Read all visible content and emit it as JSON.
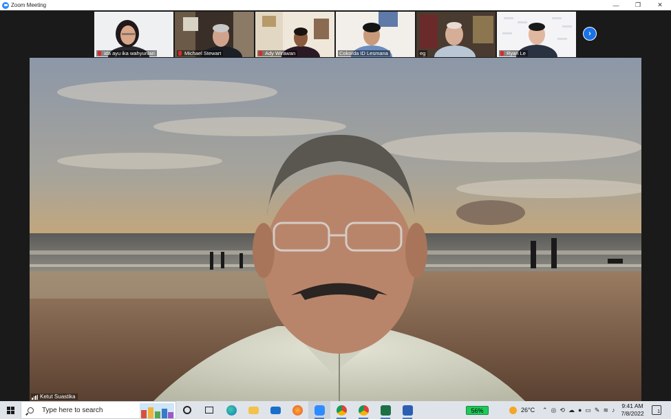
{
  "window": {
    "title": "Zoom Meeting",
    "controls": {
      "minimize": "—",
      "restore": "❐",
      "close": "✕"
    }
  },
  "gallery": {
    "participants": [
      {
        "name": "ida ayu ika wahyuniari",
        "muted": true
      },
      {
        "name": "Michael Stewart",
        "muted": true
      },
      {
        "name": "Ady Wirawan",
        "muted": true
      },
      {
        "name": "Cokorda ID Lesmana",
        "muted": false
      },
      {
        "name": "eg",
        "muted": false
      },
      {
        "name": "Ryan Le",
        "muted": true
      }
    ],
    "next_icon": "chevron-right-icon"
  },
  "active_speaker": {
    "name": "Ketut Suastika"
  },
  "taskbar": {
    "search_placeholder": "Type here to search",
    "battery_percent": "56%",
    "weather_temp": "26°C",
    "time": "9:41 AM",
    "date": "7/8/2022",
    "notification_count": "1"
  }
}
